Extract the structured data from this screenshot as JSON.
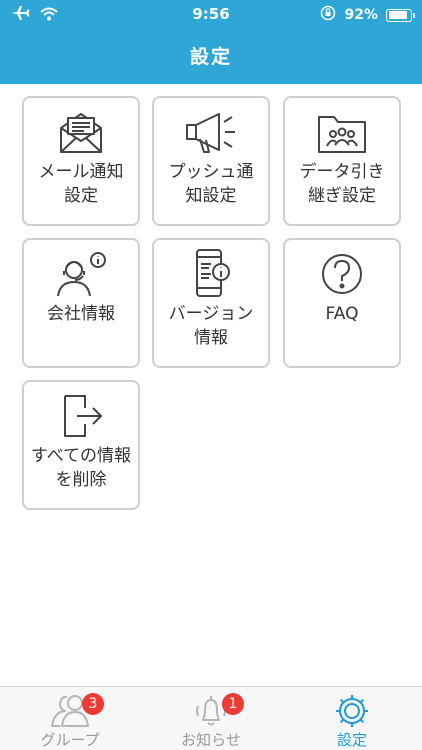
{
  "status_bar": {
    "time": "9:56",
    "battery": "92%"
  },
  "header": {
    "title": "設定"
  },
  "tiles": [
    {
      "label": "メール通知\n設定",
      "icon": "mail-icon"
    },
    {
      "label": "プッシュ通\n知設定",
      "icon": "megaphone-icon"
    },
    {
      "label": "データ引き\n継ぎ設定",
      "icon": "folder-users-icon"
    },
    {
      "label": "会社情報",
      "icon": "operator-info-icon"
    },
    {
      "label": "バージョン\n情報",
      "icon": "phone-info-icon"
    },
    {
      "label": "FAQ",
      "icon": "question-icon"
    },
    {
      "label": "すべての情報\nを削除",
      "icon": "exit-icon"
    }
  ],
  "tabbar": {
    "tabs": [
      {
        "label": "グループ",
        "badge": "3",
        "icon": "group-icon"
      },
      {
        "label": "お知らせ",
        "badge": "1",
        "icon": "bell-icon"
      },
      {
        "label": "設定",
        "icon": "gear-icon",
        "active": true
      }
    ]
  },
  "colors": {
    "header": "#2fa7d6",
    "accent": "#1e9bd7",
    "badge": "#ef3b36"
  }
}
